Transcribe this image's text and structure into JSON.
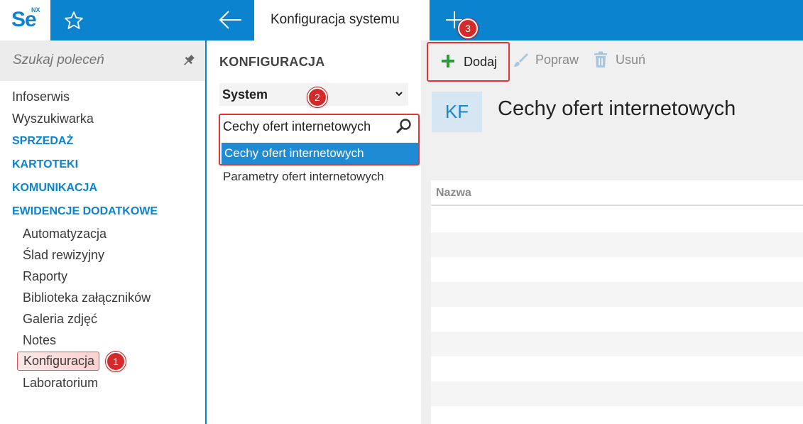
{
  "app": {
    "logo_text": "Se",
    "logo_badge": "NX"
  },
  "tabs": {
    "active_label": "Konfiguracja systemu"
  },
  "sidebar": {
    "search_placeholder": "Szukaj poleceń",
    "items": [
      {
        "label": "Infoserwis"
      },
      {
        "label": "Wyszukiwarka"
      }
    ],
    "sections": [
      {
        "label": "SPRZEDAŻ"
      },
      {
        "label": "KARTOTEKI"
      },
      {
        "label": "KOMUNIKACJA"
      },
      {
        "label": "EWIDENCJE DODATKOWE"
      }
    ],
    "sub_items": [
      {
        "label": "Automatyzacja"
      },
      {
        "label": "Ślad rewizyjny"
      },
      {
        "label": "Raporty"
      },
      {
        "label": "Biblioteka załączników"
      },
      {
        "label": "Galeria zdjęć"
      },
      {
        "label": "Notes"
      },
      {
        "label": "Konfiguracja"
      },
      {
        "label": "Laboratorium"
      }
    ]
  },
  "config_panel": {
    "title": "KONFIGURACJA",
    "category_selected": "System",
    "search_value": "Cechy ofert internetowych",
    "results": [
      {
        "label": "Cechy ofert internetowych"
      },
      {
        "label": "Parametry ofert internetowych"
      }
    ]
  },
  "toolbar": {
    "add_label": "Dodaj",
    "edit_label": "Popraw",
    "delete_label": "Usuń"
  },
  "main": {
    "badge": "KF",
    "title": "Cechy ofert internetowych",
    "grid": {
      "columns": [
        "Nazwa"
      ]
    }
  },
  "steps": {
    "one": "1",
    "two": "2",
    "three": "3"
  },
  "colors": {
    "accent": "#0b83cf",
    "selection": "#1e8bd4",
    "highlight_border": "#e23636",
    "add_icon": "#2e9a3a",
    "marker": "#d42a2a"
  }
}
